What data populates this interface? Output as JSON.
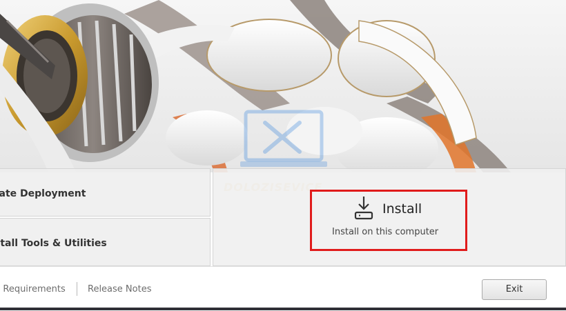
{
  "hero": {
    "image_name": "autodesk-3d-printed-part-artwork"
  },
  "watermark": {
    "text": "DOLOZISEVICE"
  },
  "left_panel": {
    "deployment_label": "eate Deployment",
    "tools_label": "stall Tools & Utilities"
  },
  "install": {
    "title": "Install",
    "subtitle": "Install on this computer",
    "icon": "download-icon",
    "highlight_color": "#e01b1b"
  },
  "footer": {
    "requirements_link": "n Requirements",
    "release_notes_link": "Release Notes",
    "exit_label": "Exit"
  }
}
